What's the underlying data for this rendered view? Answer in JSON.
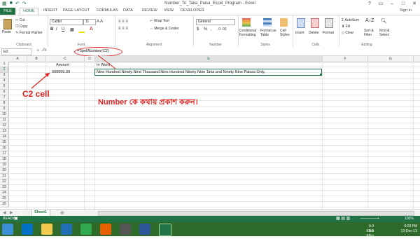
{
  "window": {
    "title": "Number_To_Taka_Paisa_Excel_Program - Excel",
    "sign_in": "Sign in"
  },
  "tabs": [
    "FILE",
    "HOME",
    "INSERT",
    "PAGE LAYOUT",
    "FORMULAS",
    "DATA",
    "REVIEW",
    "VIEW",
    "DEVELOPER"
  ],
  "ribbon": {
    "clipboard": {
      "label": "Clipboard",
      "paste": "Paste",
      "cut": "Cut",
      "copy": "Copy",
      "format_painter": "Format Painter"
    },
    "font": {
      "label": "Font",
      "font_name": "Calibri",
      "font_size": "11",
      "bold": "B",
      "italic": "I",
      "underline": "U"
    },
    "alignment": {
      "label": "Alignment",
      "wrap_text": "Wrap Text",
      "merge_center": "Merge & Center"
    },
    "number": {
      "label": "Number",
      "format": "General",
      "currency": "$",
      "percent": "%",
      "comma": ","
    },
    "styles": {
      "label": "Styles",
      "conditional": "Conditional",
      "conditional2": "Formatting",
      "format_as": "Format as",
      "table": "Table",
      "cell": "Cell",
      "styles2": "Styles"
    },
    "cells": {
      "label": "Cells",
      "insert": "Insert",
      "delete": "Delete",
      "format": "Format"
    },
    "editing": {
      "label": "Editing",
      "autosum": "AutoSum",
      "fill": "Fill",
      "clear": "Clear",
      "sort": "Sort &",
      "filter": "Filter",
      "find": "Find &",
      "select": "Select"
    }
  },
  "formula_bar": {
    "name_box": "E2",
    "fx": "fx",
    "formula": "=SpellNumber(C2)"
  },
  "columns": [
    "A",
    "B",
    "C",
    "D",
    "E",
    "F",
    "G",
    "H",
    "I"
  ],
  "rows": [
    "1",
    "2",
    "3",
    "4",
    "5",
    "6",
    "7",
    "8",
    "9",
    "10",
    "11",
    "12",
    "13",
    "14",
    "15",
    "16",
    "17",
    "18",
    "19",
    "20",
    "21",
    "22",
    "23",
    "24",
    "25",
    "26"
  ],
  "cells": {
    "c1": "Amount",
    "e1": "In Word",
    "c2": "999999.99",
    "e2": "Nine Hundred Ninety Nine Thousand Nine Hundred Ninety Nine Taka and Ninety Nine Paisas Only."
  },
  "annotations": {
    "c2_cell": "C2  cell",
    "number_note": "Number কে কথায় প্রকাশ করুন।"
  },
  "sheets": {
    "active": "Sheet1",
    "add": "⊕"
  },
  "status": {
    "ready": "READY",
    "zoom": "100%"
  },
  "taskbar": {
    "net1": "0.0 KB/s",
    "net2": "0.0 KB/s",
    "time": "9:28 PM",
    "date": "13-Dec-13"
  },
  "colors": {
    "excel_green": "#217346",
    "annotation_red": "#e02020"
  }
}
